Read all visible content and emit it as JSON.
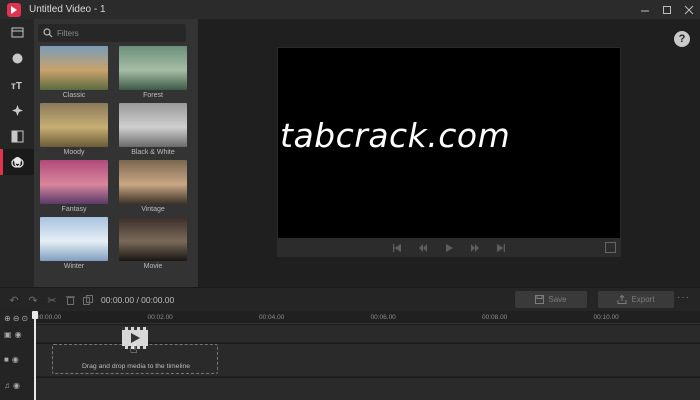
{
  "window": {
    "title": "Untitled Video - 1",
    "controls": [
      "minimize",
      "maximize",
      "close"
    ]
  },
  "rail": {
    "items": [
      {
        "name": "media",
        "icon": "media-icon"
      },
      {
        "name": "effects",
        "icon": "palette-icon"
      },
      {
        "name": "text",
        "icon": "text-icon"
      },
      {
        "name": "elements",
        "icon": "sparkle-icon"
      },
      {
        "name": "transitions",
        "icon": "transition-icon"
      },
      {
        "name": "filters",
        "icon": "filter-icon",
        "active": true
      }
    ]
  },
  "panel": {
    "search_placeholder": "Filters",
    "filters": [
      {
        "label": "Classic",
        "colors": [
          "#7a9cb8",
          "#c9a26b",
          "#5b6b3f"
        ]
      },
      {
        "label": "Forest",
        "colors": [
          "#6c8f7b",
          "#a6bda5",
          "#3e5a48"
        ]
      },
      {
        "label": "Moody",
        "colors": [
          "#8a7a5a",
          "#c7ae72",
          "#6b5b38"
        ]
      },
      {
        "label": "Black & White",
        "colors": [
          "#9a9a9a",
          "#cfcfcf",
          "#6a6a6a"
        ]
      },
      {
        "label": "Fantasy",
        "colors": [
          "#b04a7a",
          "#d8869c",
          "#5a3a6a"
        ]
      },
      {
        "label": "Vintage",
        "colors": [
          "#7b6750",
          "#c9a784",
          "#3c3228"
        ]
      },
      {
        "label": "Winter",
        "colors": [
          "#a9c3df",
          "#e6eef5",
          "#7f9fbf"
        ]
      },
      {
        "label": "Movie",
        "colors": [
          "#3a2e28",
          "#7a6a5a",
          "#1a1614"
        ]
      }
    ]
  },
  "preview": {
    "watermark": "tabcrack.com",
    "help_label": "?"
  },
  "toolbar": {
    "timecode": "00:00.00 / 00:00.00",
    "save_label": "Save",
    "export_label": "Export",
    "more_label": "···"
  },
  "timeline": {
    "ticks": [
      "00:00.00",
      "00:02.00",
      "00:04.00",
      "00:06.00",
      "00:08.00",
      "00:10.00"
    ],
    "drop_text": "Drag and drop media to the timeline"
  }
}
